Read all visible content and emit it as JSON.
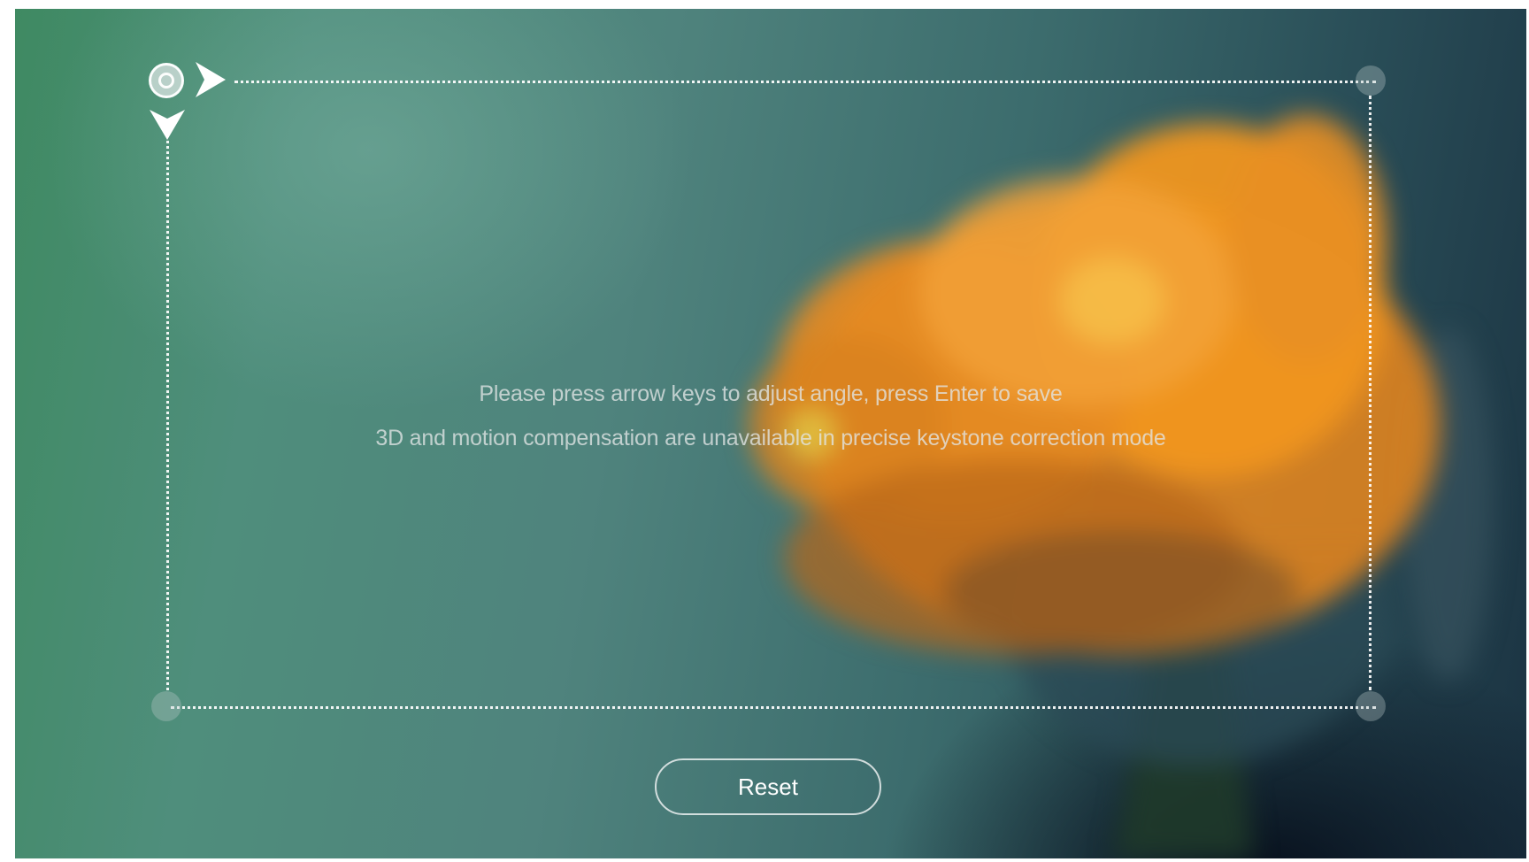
{
  "instructions": {
    "line1": "Please press arrow keys to adjust angle, press Enter to save",
    "line2": "3D and motion compensation are unavailable in precise keystone correction mode"
  },
  "controls": {
    "reset_label": "Reset"
  },
  "keystone": {
    "selected_corner": "top-left",
    "arrow_hints": [
      "arrow-right-icon",
      "arrow-down-icon"
    ]
  },
  "colors": {
    "frame": "#ffffff",
    "flower_orange": "#e58a1e",
    "background_green": "#3f8a62",
    "background_dark": "#050b18"
  }
}
